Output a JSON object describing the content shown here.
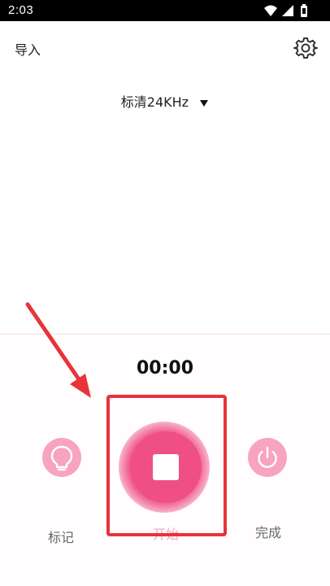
{
  "status_bar": {
    "time": "2:03",
    "icons": [
      "wifi-icon",
      "signal-icon",
      "battery-icon"
    ]
  },
  "header": {
    "import_label": "导入",
    "settings_icon": "gear-icon"
  },
  "quality": {
    "label": "标清24KHz",
    "dropdown_icon": "triangle-down-icon"
  },
  "timer": {
    "value": "00:00"
  },
  "controls": {
    "mark": {
      "label": "标记",
      "icon": "bulb-icon"
    },
    "record": {
      "label": "开始",
      "icon": "stop-icon"
    },
    "done": {
      "label": "完成",
      "icon": "power-icon"
    }
  },
  "colors": {
    "accent": "#ef4f85",
    "accent_light": "#f7a3c1",
    "highlight": "#e8333a"
  }
}
